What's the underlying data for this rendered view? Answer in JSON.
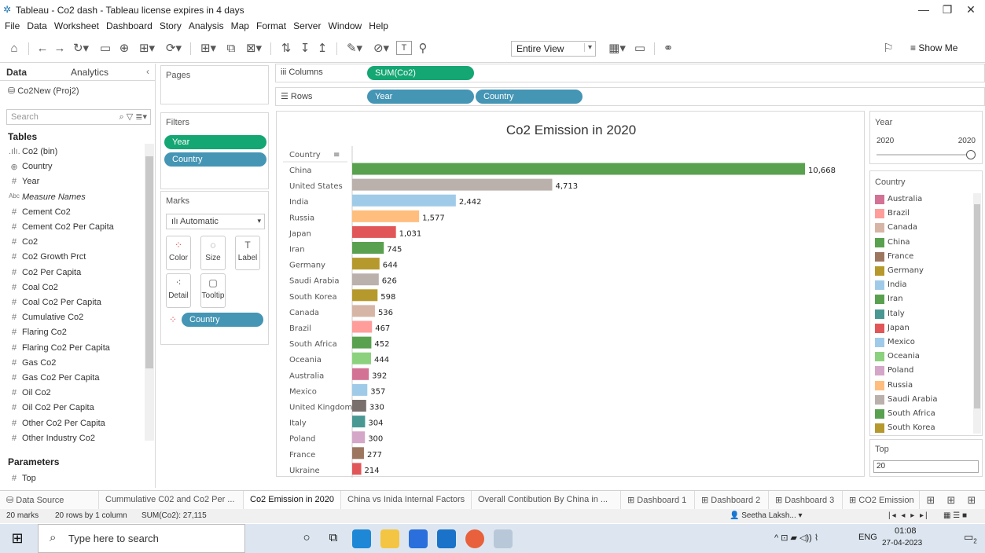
{
  "window": {
    "title": "Tableau - Co2 dash - Tableau license expires in 4 days"
  },
  "menu": [
    "File",
    "Data",
    "Worksheet",
    "Dashboard",
    "Story",
    "Analysis",
    "Map",
    "Format",
    "Server",
    "Window",
    "Help"
  ],
  "toolbar": {
    "fit_value": "Entire View",
    "show_me": "Show Me"
  },
  "data_pane": {
    "tab_data": "Data",
    "tab_analytics": "Analytics",
    "datasource": "Co2New (Proj2)",
    "search_placeholder": "Search",
    "tables_header": "Tables",
    "fields": [
      {
        "type": ".ılı.",
        "name": "Co2 (bin)"
      },
      {
        "type": "⊕",
        "name": "Country"
      },
      {
        "type": "#",
        "name": "Year"
      },
      {
        "type": "Abc",
        "name": "Measure Names"
      },
      {
        "type": "#",
        "name": "Cement Co2"
      },
      {
        "type": "#",
        "name": "Cement Co2 Per Capita"
      },
      {
        "type": "#",
        "name": "Co2"
      },
      {
        "type": "#",
        "name": "Co2 Growth Prct"
      },
      {
        "type": "#",
        "name": "Co2 Per Capita"
      },
      {
        "type": "#",
        "name": "Coal Co2"
      },
      {
        "type": "#",
        "name": "Coal Co2 Per Capita"
      },
      {
        "type": "#",
        "name": "Cumulative Co2"
      },
      {
        "type": "#",
        "name": "Flaring Co2"
      },
      {
        "type": "#",
        "name": "Flaring Co2 Per Capita"
      },
      {
        "type": "#",
        "name": "Gas Co2"
      },
      {
        "type": "#",
        "name": "Gas Co2 Per Capita"
      },
      {
        "type": "#",
        "name": "Oil Co2"
      },
      {
        "type": "#",
        "name": "Oil Co2 Per Capita"
      },
      {
        "type": "#",
        "name": "Other Co2 Per Capita"
      },
      {
        "type": "#",
        "name": "Other Industry Co2"
      }
    ],
    "parameters_header": "Parameters",
    "parameter": "Top"
  },
  "shelves": {
    "pages": "Pages",
    "columns_label": "Columns",
    "rows_label": "Rows",
    "columns_pill": "SUM(Co2)",
    "rows_pills": [
      "Year",
      "Country"
    ],
    "filters": "Filters",
    "filter_pills": [
      "Year",
      "Country"
    ],
    "marks": "Marks",
    "mark_type": "Automatic",
    "mark_buttons": [
      "Color",
      "Size",
      "Label",
      "Detail",
      "Tooltip"
    ],
    "marks_pill": "Country"
  },
  "chart_data": {
    "type": "bar",
    "title": "Co2 Emission in 2020",
    "row_header": "Country",
    "categories": [
      "China",
      "United States",
      "India",
      "Russia",
      "Japan",
      "Iran",
      "Germany",
      "Saudi Arabia",
      "South Korea",
      "Canada",
      "Brazil",
      "South Africa",
      "Oceania",
      "Australia",
      "Mexico",
      "United Kingdom",
      "Italy",
      "Poland",
      "France",
      "Ukraine"
    ],
    "values": [
      10668,
      4713,
      2442,
      1577,
      1031,
      745,
      644,
      626,
      598,
      536,
      467,
      452,
      444,
      392,
      357,
      330,
      304,
      300,
      277,
      214
    ],
    "value_labels": [
      "10,668",
      "4,713",
      "2,442",
      "1,577",
      "1,031",
      "745",
      "644",
      "626",
      "598",
      "536",
      "467",
      "452",
      "444",
      "392",
      "357",
      "330",
      "304",
      "300",
      "277",
      "214"
    ],
    "colors": [
      "#59a14f",
      "#bab0ac",
      "#a0cbe8",
      "#ffbe7d",
      "#e15759",
      "#59a14f",
      "#b6992d",
      "#bab0ac",
      "#b6992d",
      "#d7b5a6",
      "#ff9d9a",
      "#59a14f",
      "#8cd17d",
      "#d37295",
      "#a0cbe8",
      "#79706e",
      "#499894",
      "#d4a6c8",
      "#9d7660",
      "#e15759"
    ],
    "xlim": [
      0,
      10668
    ]
  },
  "year_filter": {
    "title": "Year",
    "min": "2020",
    "max": "2020"
  },
  "legend": {
    "title": "Country",
    "items": [
      {
        "name": "Australia",
        "color": "#d37295"
      },
      {
        "name": "Brazil",
        "color": "#ff9d9a"
      },
      {
        "name": "Canada",
        "color": "#d7b5a6"
      },
      {
        "name": "China",
        "color": "#59a14f"
      },
      {
        "name": "France",
        "color": "#9d7660"
      },
      {
        "name": "Germany",
        "color": "#b6992d"
      },
      {
        "name": "India",
        "color": "#a0cbe8"
      },
      {
        "name": "Iran",
        "color": "#59a14f"
      },
      {
        "name": "Italy",
        "color": "#499894"
      },
      {
        "name": "Japan",
        "color": "#e15759"
      },
      {
        "name": "Mexico",
        "color": "#a0cbe8"
      },
      {
        "name": "Oceania",
        "color": "#8cd17d"
      },
      {
        "name": "Poland",
        "color": "#d4a6c8"
      },
      {
        "name": "Russia",
        "color": "#ffbe7d"
      },
      {
        "name": "Saudi Arabia",
        "color": "#bab0ac"
      },
      {
        "name": "South Africa",
        "color": "#59a14f"
      },
      {
        "name": "South Korea",
        "color": "#b6992d"
      }
    ]
  },
  "top_param": {
    "title": "Top",
    "value": "20"
  },
  "sheet_tabs": [
    "Data Source",
    "Cummulative C02 and Co2 Per ...",
    "Co2 Emission in 2020",
    "China vs Inida Internal Factors",
    "Overall Contibution By China in ...",
    "Dashboard 1",
    "Dashboard 2",
    "Dashboard 3",
    "CO2 Emission"
  ],
  "status": {
    "marks": "20 marks",
    "rows": "20 rows by 1 column",
    "sum": "SUM(Co2): 27,115",
    "user": "Seetha Laksh..."
  },
  "taskbar": {
    "search_placeholder": "Type here to search",
    "lang": "ENG",
    "time": "01:08",
    "date": "27-04-2023",
    "notif": "2"
  }
}
